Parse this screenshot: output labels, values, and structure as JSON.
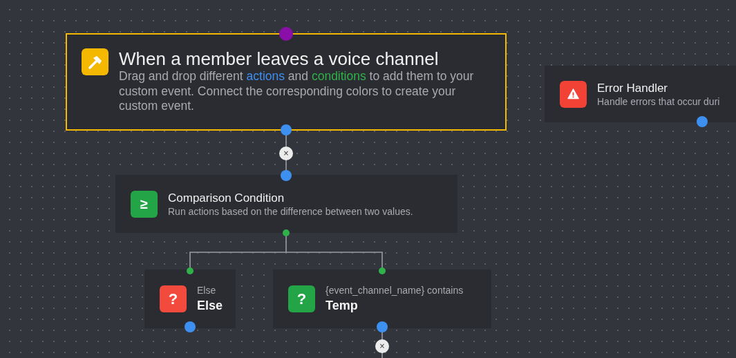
{
  "nodes": [
    {
      "kind": "event",
      "selected": true,
      "color": "#f5b800",
      "title": "When a member leaves a voice channel",
      "description": [
        {
          "text": "Drag and drop different "
        },
        {
          "text": "actions",
          "color": "#3d8ff0"
        },
        {
          "text": " and "
        },
        {
          "text": "conditions",
          "color": "#2fb24a"
        },
        {
          "text": " to add them to your custom event. Connect the corresponding colors to create your custom event."
        }
      ]
    },
    {
      "kind": "handler",
      "selected": false,
      "color": "#f24236",
      "title": "Error Handler",
      "subtitle": "Handle errors that occur duri"
    },
    {
      "kind": "condition",
      "selected": false,
      "color": "#23a547",
      "glyph": "≥",
      "title": "Comparison Condition",
      "subtitle": "Run actions based on the difference between two values."
    },
    {
      "kind": "branch",
      "selected": false,
      "color": "#f24a3c",
      "glyph": "?",
      "label": "Else",
      "title": "Else"
    },
    {
      "kind": "branch",
      "selected": false,
      "color": "#23a547",
      "glyph": "?",
      "label": "{event_channel_name} contains",
      "title": "Temp"
    }
  ],
  "connectors": [
    {
      "label": "×"
    },
    {
      "label": "×"
    }
  ]
}
